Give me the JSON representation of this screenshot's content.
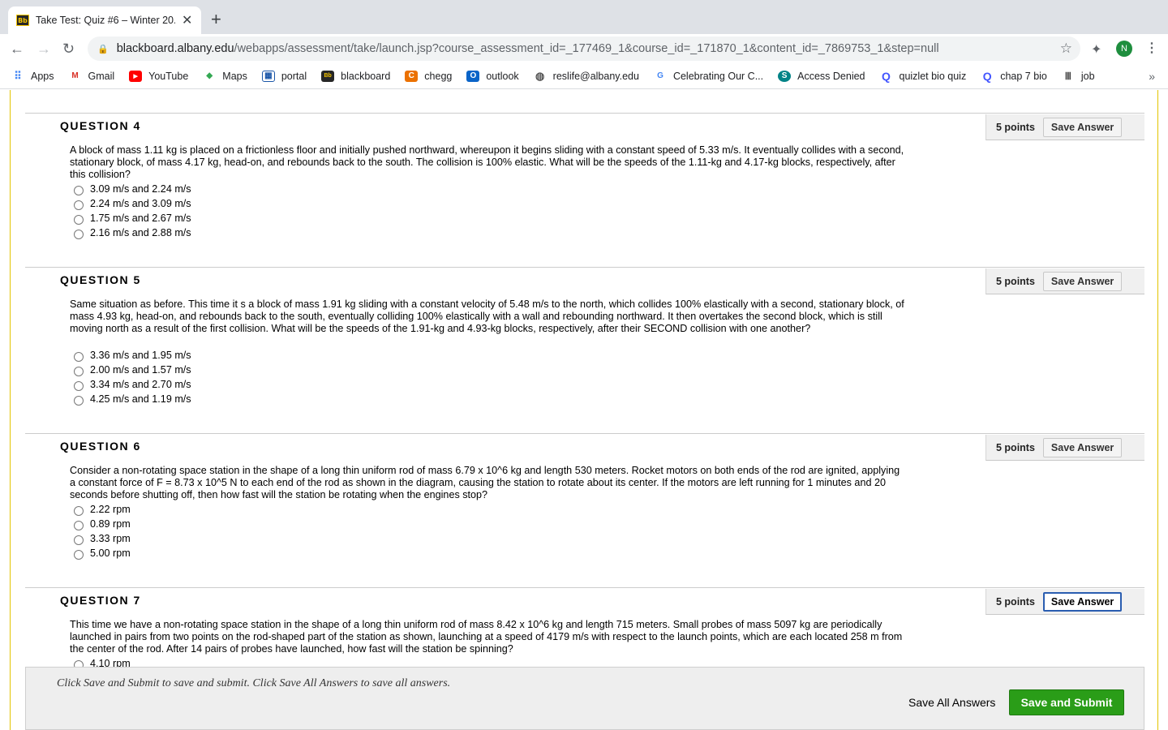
{
  "browser": {
    "tab_title": "Take Test: Quiz #6 – Winter 20...",
    "tab_favicon": "Bb",
    "url_host": "blackboard.albany.edu",
    "url_path": "/webapps/assessment/take/launch.jsp?course_assessment_id=_177469_1&course_id=_171870_1&content_id=_7869753_1&step=null",
    "profile_initial": "N"
  },
  "bookmarks": [
    {
      "label": "Apps",
      "icon": "apps-grid-icon"
    },
    {
      "label": "Gmail",
      "icon": "gmail-icon"
    },
    {
      "label": "YouTube",
      "icon": "youtube-icon"
    },
    {
      "label": "Maps",
      "icon": "maps-icon"
    },
    {
      "label": "portal",
      "icon": "portal-icon"
    },
    {
      "label": "blackboard",
      "icon": "blackboard-icon"
    },
    {
      "label": "chegg",
      "icon": "chegg-icon"
    },
    {
      "label": "outlook",
      "icon": "outlook-icon"
    },
    {
      "label": "reslife@albany.edu",
      "icon": "globe-icon"
    },
    {
      "label": "Celebrating Our C...",
      "icon": "google-icon"
    },
    {
      "label": "Access Denied",
      "icon": "sharepoint-icon"
    },
    {
      "label": "quizlet bio quiz",
      "icon": "quizlet-icon"
    },
    {
      "label": "chap 7 bio",
      "icon": "quizlet-icon"
    },
    {
      "label": "job",
      "icon": "building-icon"
    }
  ],
  "questions": [
    {
      "title": "QUESTION 4",
      "points": "5 points",
      "save_label": "Save Answer",
      "text": "A block of mass 1.11 kg is placed on a frictionless floor and initially pushed northward, whereupon it begins sliding with a constant speed of 5.33 m/s. It eventually collides with a second, stationary block, of mass 4.17 kg, head-on, and rebounds back to the south. The collision is 100% elastic. What will be the speeds of the 1.11-kg and 4.17-kg blocks, respectively, after this collision?",
      "answers": [
        "3.09 m/s and 2.24 m/s",
        "2.24 m/s and 3.09 m/s",
        "1.75 m/s and 2.67 m/s",
        "2.16 m/s and 2.88 m/s"
      ]
    },
    {
      "title": "QUESTION 5",
      "points": "5 points",
      "save_label": "Save Answer",
      "text": "Same situation as before. This time it s a block of mass 1.91 kg sliding with a constant velocity of 5.48 m/s to the north, which collides 100% elastically with a second, stationary block, of mass 4.93 kg, head-on, and rebounds back to the south, eventually colliding 100% elastically with a wall and rebounding northward. It then overtakes the second block, which is still moving north as a result of the first collision. What will be the speeds of the 1.91-kg and 4.93-kg blocks, respectively, after their SECOND collision with one another?",
      "answers": [
        "3.36 m/s and 1.95 m/s",
        "2.00 m/s and 1.57 m/s",
        "3.34 m/s and 2.70 m/s",
        "4.25 m/s and 1.19 m/s"
      ]
    },
    {
      "title": "QUESTION 6",
      "points": "5 points",
      "save_label": "Save Answer",
      "text": "Consider a non-rotating space station in the shape of a long thin uniform rod of mass 6.79 x 10^6 kg and length 530 meters. Rocket motors on both ends of the rod are ignited, applying a constant force of F = 8.73 x 10^5 N to each end of the rod as shown in the diagram, causing the station to rotate about its center. If the motors are left running for 1 minutes and 20 seconds before shutting off, then how fast will the station be rotating when the engines stop?",
      "answers": [
        "2.22 rpm",
        "0.89 rpm",
        "3.33 rpm",
        "5.00 rpm"
      ]
    },
    {
      "title": "QUESTION 7",
      "points": "5 points",
      "save_label": "Save Answer",
      "text": "This time we have a non-rotating space station in the shape of a long thin uniform rod of mass 8.42 x 10^6 kg and length 715 meters. Small probes of mass 5097 kg are periodically launched in pairs from two points on the rod-shaped part of the station as shown, launching at a speed of 4179 m/s with respect to the launch points, which are each located 258 m from the center of the rod. After 14 pairs of probes have launched, how fast will the station be spinning?",
      "answers": [
        "4.10 rpm"
      ]
    }
  ],
  "footer": {
    "instructions": "Click Save and Submit to save and submit. Click Save All Answers to save all answers.",
    "save_all_label": "Save All Answers",
    "submit_label": "Save and Submit"
  }
}
